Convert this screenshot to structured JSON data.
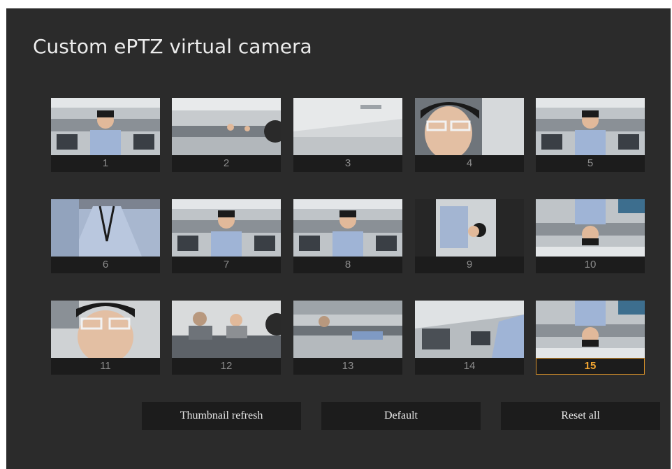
{
  "window": {
    "title": "Custom ePTZ virtual camera"
  },
  "presets": {
    "selected": "15",
    "items": [
      {
        "label": "1"
      },
      {
        "label": "2"
      },
      {
        "label": "3"
      },
      {
        "label": "4"
      },
      {
        "label": "5"
      },
      {
        "label": "6"
      },
      {
        "label": "7"
      },
      {
        "label": "8"
      },
      {
        "label": "9"
      },
      {
        "label": "10"
      },
      {
        "label": "11"
      },
      {
        "label": "12"
      },
      {
        "label": "13"
      },
      {
        "label": "14"
      },
      {
        "label": "15"
      }
    ]
  },
  "actions": {
    "thumbnail_refresh": "Thumbnail refresh",
    "default": "Default",
    "reset_all": "Reset all"
  },
  "colors": {
    "panel_bg": "#2b2b2b",
    "caption_bg": "#1c1c1c",
    "selected_accent": "#f2a531"
  }
}
